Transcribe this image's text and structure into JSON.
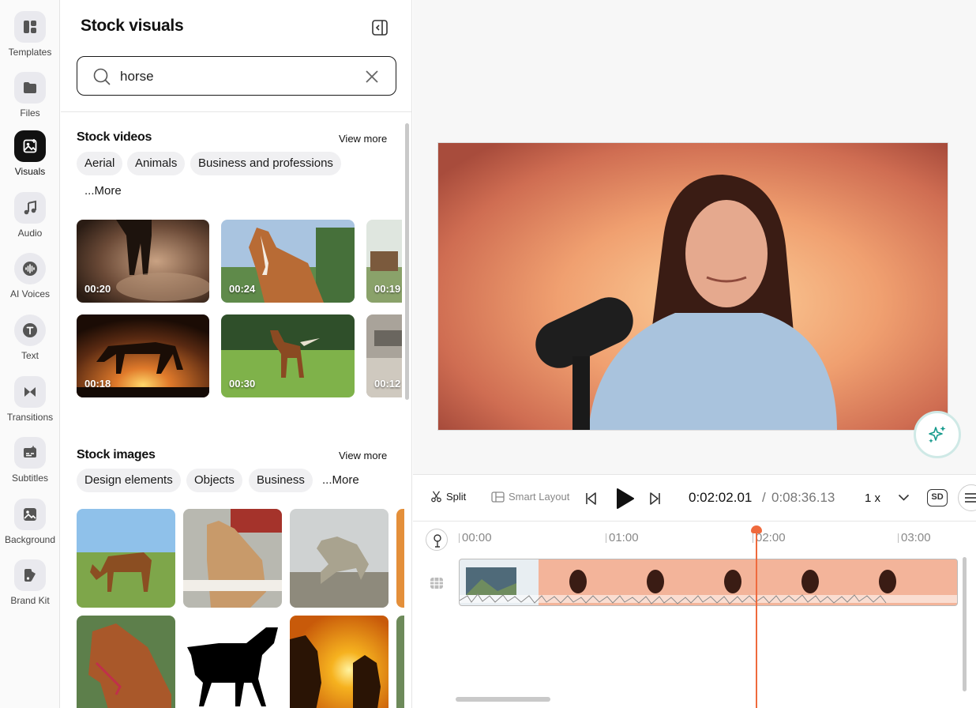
{
  "nav": {
    "items": [
      {
        "label": "Templates",
        "icon": "templates-icon"
      },
      {
        "label": "Files",
        "icon": "folder-icon"
      },
      {
        "label": "Visuals",
        "icon": "visuals-icon",
        "active": true
      },
      {
        "label": "Audio",
        "icon": "music-note-icon"
      },
      {
        "label": "AI Voices",
        "icon": "waveform-icon"
      },
      {
        "label": "Text",
        "icon": "text-icon"
      },
      {
        "label": "Transitions",
        "icon": "transition-icon"
      },
      {
        "label": "Subtitles",
        "icon": "subtitles-icon"
      },
      {
        "label": "Background",
        "icon": "background-icon"
      },
      {
        "label": "Brand Kit",
        "icon": "brand-kit-icon"
      }
    ]
  },
  "panel": {
    "title": "Stock visuals",
    "search": {
      "value": "horse",
      "placeholder": "Search"
    },
    "videos": {
      "title": "Stock videos",
      "view_more": "View more",
      "chips": [
        "Aerial",
        "Animals",
        "Business and professions",
        "...More"
      ],
      "items": [
        {
          "duration": "00:20"
        },
        {
          "duration": "00:24"
        },
        {
          "duration": "00:19"
        },
        {
          "duration": "00:18"
        },
        {
          "duration": "00:30"
        },
        {
          "duration": "00:12"
        }
      ]
    },
    "images": {
      "title": "Stock images",
      "view_more": "View more",
      "chips": [
        "Design elements",
        "Objects",
        "Business",
        "...More"
      ]
    }
  },
  "toolbar": {
    "split_label": "Split",
    "smart_layout_label": "Smart Layout",
    "current_time": "0:02:02.01",
    "separator": "/",
    "total_time": "0:08:36.13",
    "speed": "1 x",
    "quality": "SD"
  },
  "timeline": {
    "ticks": [
      "00:00",
      "01:00",
      "02:00",
      "03:00"
    ]
  },
  "colors": {
    "accent": "#ef6a3d",
    "active_nav": "#111111",
    "ai_button_ring": "#cfe9e6",
    "ai_icon": "#159a8c"
  }
}
